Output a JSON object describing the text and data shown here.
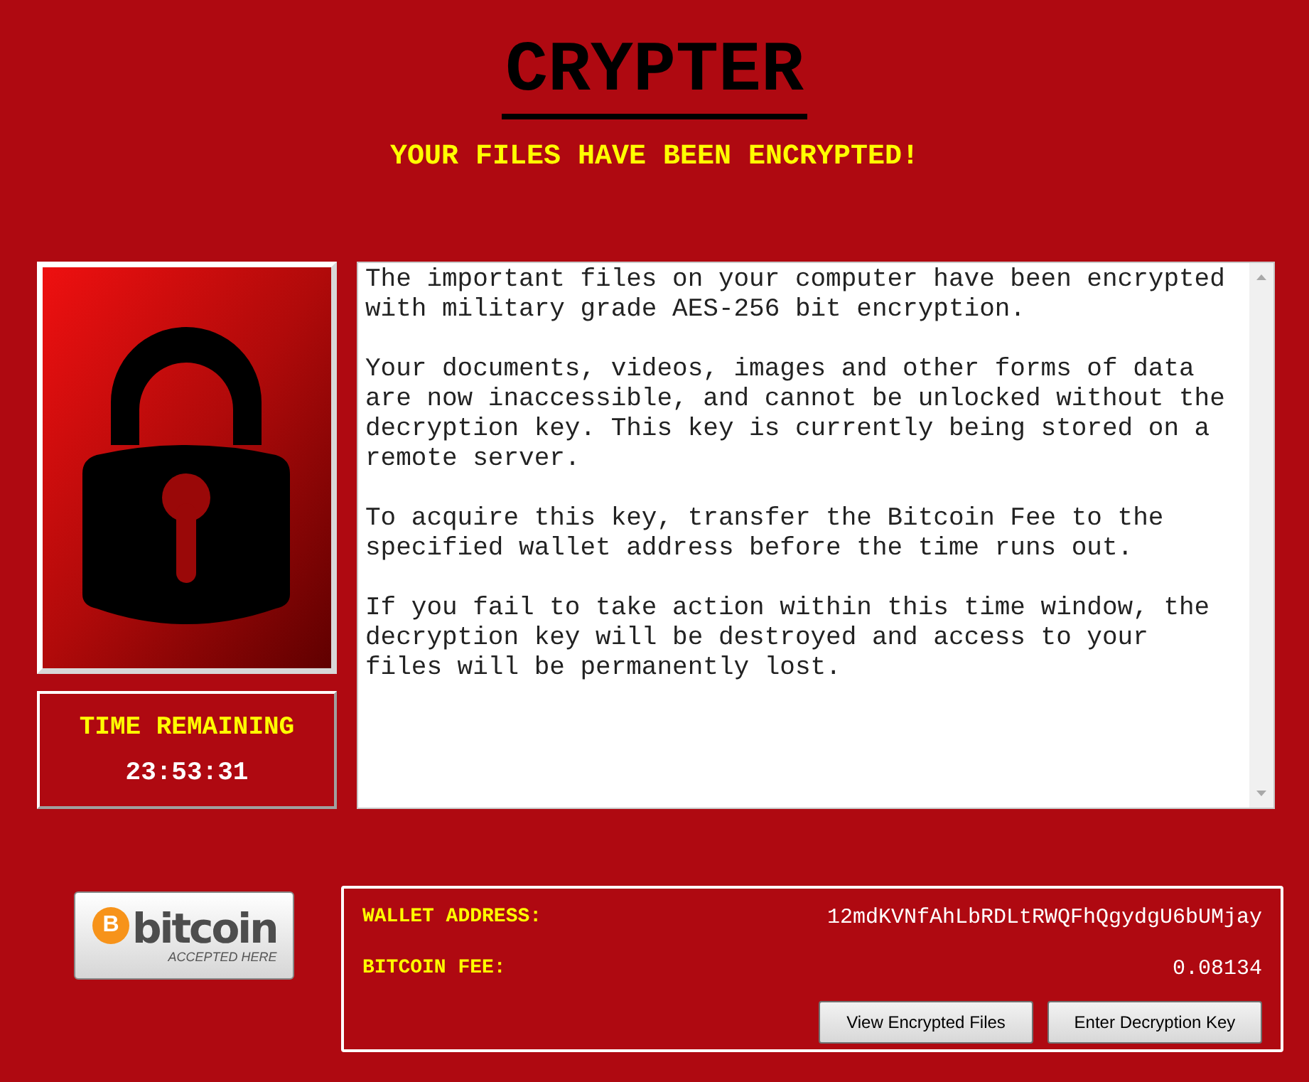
{
  "header": {
    "title": "CRYPTER",
    "subtitle": "YOUR FILES HAVE BEEN ENCRYPTED!"
  },
  "timer": {
    "label": "TIME REMAINING",
    "value": "23:53:31"
  },
  "message": {
    "paragraphs": [
      "The important files on your computer have been encrypted with military grade AES-256 bit encryption.",
      "Your documents, videos, images and other forms of data are now inaccessible, and cannot be unlocked without the decryption key. This key is currently being stored on a remote server.",
      "To acquire this key, transfer the Bitcoin Fee to the specified wallet address before the time runs out.",
      "If you fail to take action within this time window, the decryption key will be destroyed and access to your files will be permanently lost."
    ]
  },
  "badge": {
    "symbol": "B",
    "name": "bitcoin",
    "caption": "ACCEPTED HERE"
  },
  "payment": {
    "fields": [
      {
        "label": "WALLET ADDRESS:",
        "value": "12mdKVNfAhLbRDLtRWQFhQgydgU6bUMjay"
      },
      {
        "label": "BITCOIN FEE:",
        "value": "0.08134"
      }
    ],
    "buttons": [
      "View Encrypted Files",
      "Enter Decryption Key"
    ]
  }
}
